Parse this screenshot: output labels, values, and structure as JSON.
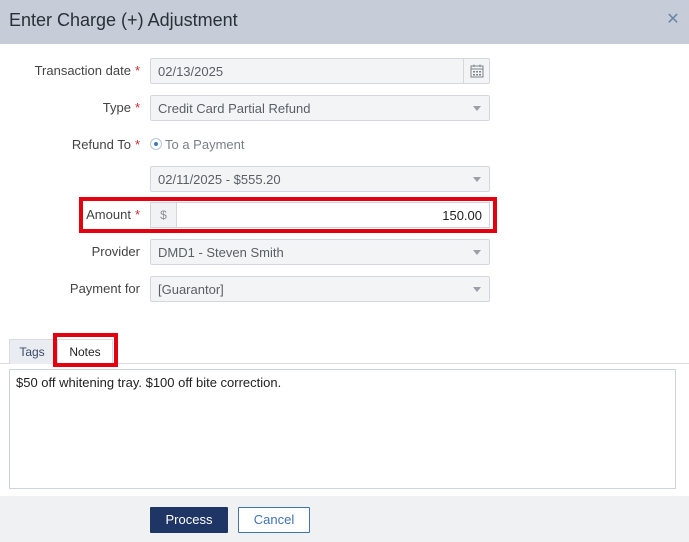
{
  "dialog": {
    "title": "Enter Charge (+) Adjustment",
    "close_icon": "close-icon"
  },
  "form": {
    "required_marker": "*",
    "transaction_date": {
      "label": "Transaction date",
      "value": "02/13/2025",
      "icon": "calendar-icon"
    },
    "type": {
      "label": "Type",
      "value": "Credit Card Partial Refund"
    },
    "refund_to": {
      "label": "Refund To",
      "option": "To a Payment",
      "payment_value": "02/11/2025 - $555.20"
    },
    "amount": {
      "label": "Amount",
      "prefix": "$",
      "value": "150.00"
    },
    "provider": {
      "label": "Provider",
      "value": "DMD1 - Steven Smith"
    },
    "payment_for": {
      "label": "Payment for",
      "value": "[Guarantor]"
    }
  },
  "tabs": [
    {
      "label": "Tags",
      "active": false
    },
    {
      "label": "Notes",
      "active": true
    }
  ],
  "notes": {
    "text": "$50 off whitening tray. $100 off bite correction."
  },
  "buttons": {
    "process": "Process",
    "cancel": "Cancel"
  },
  "colors": {
    "header_bg": "#c6ccd8",
    "required": "#d0282b",
    "highlight": "#e3000f",
    "primary_button": "#1f3566",
    "cancel_border": "#3f73b1"
  }
}
